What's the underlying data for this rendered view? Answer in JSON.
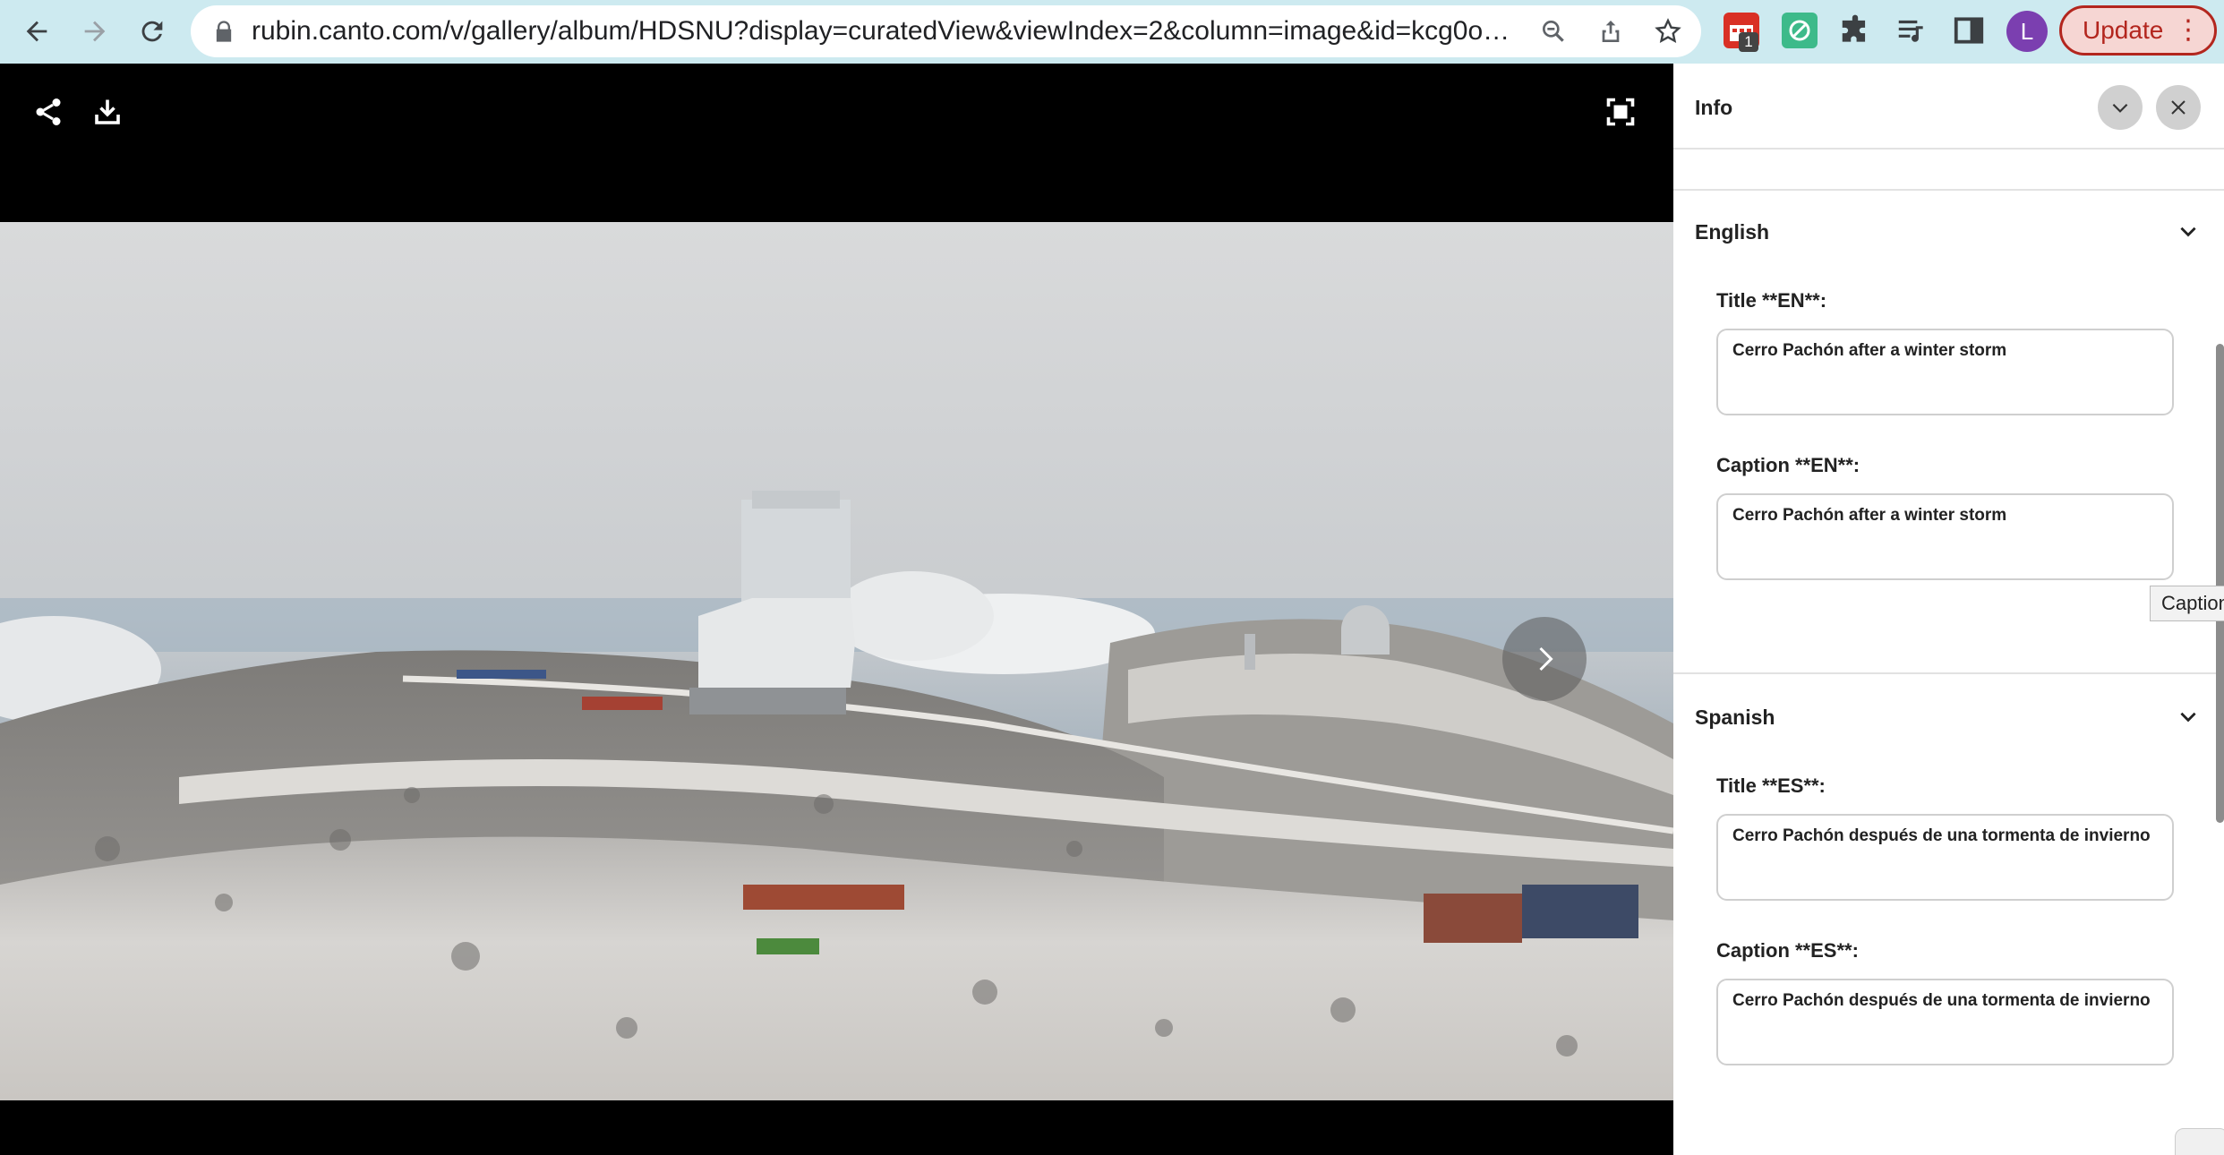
{
  "browser": {
    "url": "rubin.canto.com/v/gallery/album/HDSNU?display=curatedView&viewIndex=2&column=image&id=kcg0oujc...",
    "extension_badge": "1",
    "avatar_letter": "L",
    "update_label": "Update",
    "menu_glyph": "⋮"
  },
  "viewer": {
    "icons": [
      "share-icon",
      "download-icon",
      "fullscreen-icon",
      "next-arrow-icon"
    ]
  },
  "panel": {
    "title": "Info",
    "sections": [
      {
        "name": "English",
        "fields": [
          {
            "label": "Title **EN**:",
            "value": "Cerro Pachón after a winter storm"
          },
          {
            "label": "Caption **EN**:",
            "value": "Cerro Pachón after a winter storm"
          }
        ]
      },
      {
        "name": "Spanish",
        "fields": [
          {
            "label": "Title **ES**:",
            "value": "Cerro Pachón después de una tormenta de invierno"
          },
          {
            "label": "Caption **ES**:",
            "value": "Cerro Pachón después de una tormenta de invierno"
          }
        ]
      }
    ],
    "tooltip": "Caption"
  },
  "colors": {
    "chrome_bg": "#cdeaf0",
    "update_accent": "#b3261e",
    "avatar_bg": "#7b3fb0"
  }
}
